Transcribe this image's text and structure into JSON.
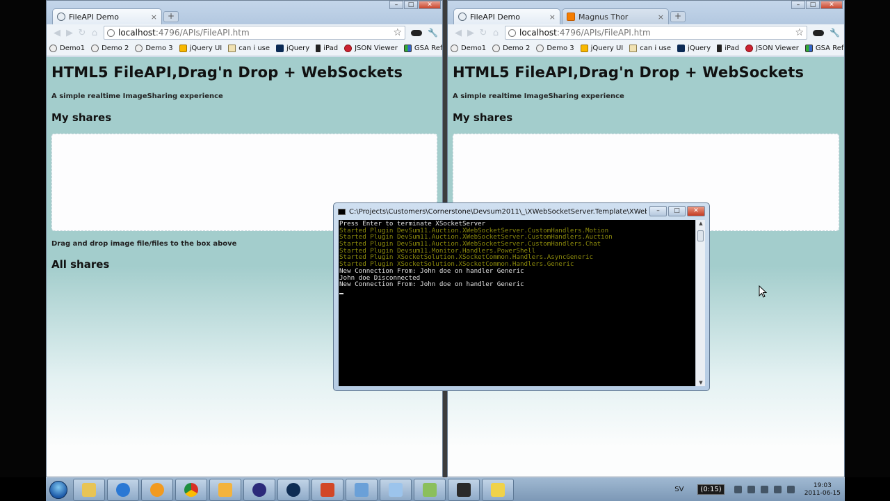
{
  "browser_left": {
    "tabs": [
      {
        "title": "FileAPI Demo",
        "close": "×"
      }
    ],
    "newtab": "+",
    "url_host": "localhost",
    "url_path": ":4796/APIs/FileAPI.htm",
    "bookmarks": [
      "Demo1",
      "Demo 2",
      "Demo 3",
      "jQuery UI",
      "can i use",
      "jQuery",
      "iPad",
      "JSON Viewer",
      "GSA Ref"
    ],
    "bookmarks_more": "»"
  },
  "browser_right": {
    "tabs": [
      {
        "title": "FileAPI Demo",
        "close": "×"
      },
      {
        "title": "Magnus Thor",
        "close": "×"
      }
    ],
    "newtab": "+",
    "url_host": "localhost",
    "url_path": ":4796/APIs/FileAPI.htm",
    "bookmarks": [
      "Demo1",
      "Demo 2",
      "Demo 3",
      "jQuery UI",
      "can i use",
      "jQuery",
      "iPad",
      "JSON Viewer",
      "GSA Ref"
    ],
    "bookmarks_more": "»"
  },
  "page": {
    "title": "HTML5 FileAPI,Drag'n Drop + WebSockets",
    "subtitle": "A simple realtime ImageSharing experience",
    "my_shares": "My shares",
    "hint": "Drag and drop image file/files to the box above",
    "all_shares": "All shares"
  },
  "console": {
    "title": "C:\\Projects\\Customers\\Cornerstone\\Devsum2011\\_\\XWebSocketServer.Template\\XWebSocketServe...",
    "lines": [
      {
        "text": "Press Enter to terminate XSocketServer",
        "color": "#e4e4e4"
      },
      {
        "text": "Started Plugin DevSum11.Auction.XWebSocketServer.CustomHandlers.Motion",
        "color": "#8c8a0c"
      },
      {
        "text": "Started Plugin DevSum11.Auction.XWebSocketServer.CustomHandlers.Auction",
        "color": "#8c8a0c"
      },
      {
        "text": "Started Plugin DevSum11.Auction.XWebSocketServer.CustomHandlers.Chat",
        "color": "#8c8a0c"
      },
      {
        "text": "Started Plugin Devsum11.Monitor.Handlers.PowerShell",
        "color": "#8c8a0c"
      },
      {
        "text": "Started Plugin XSocketSolution.XSocketCommon.Handlers.AsyncGeneric",
        "color": "#8c8a0c"
      },
      {
        "text": "Started Plugin XSocketSolution.XSocketCommon.Handlers.Generic",
        "color": "#8c8a0c"
      },
      {
        "text": "New Connection From: John doe on handler Generic",
        "color": "#e4e4e4"
      },
      {
        "text": "John doe Disconnected",
        "color": "#e4e4e4"
      },
      {
        "text": "New Connection From: John doe on handler Generic",
        "color": "#e4e4e4"
      }
    ]
  },
  "taskbar": {
    "lang": "SV",
    "battery": "(0:15)",
    "time": "19:03",
    "date": "2011-06-15",
    "apps": [
      "explorer",
      "internet-explorer",
      "media-player",
      "chrome",
      "outlook",
      "visual-studio",
      "media-center",
      "powerpoint",
      "remote-desktop",
      "paint",
      "file-manager",
      "camera",
      "star"
    ]
  },
  "colors": {
    "page_bg": "#a3cdcc",
    "console_text_yellow": "#8c8a0c",
    "console_text_white": "#e4e4e4"
  }
}
